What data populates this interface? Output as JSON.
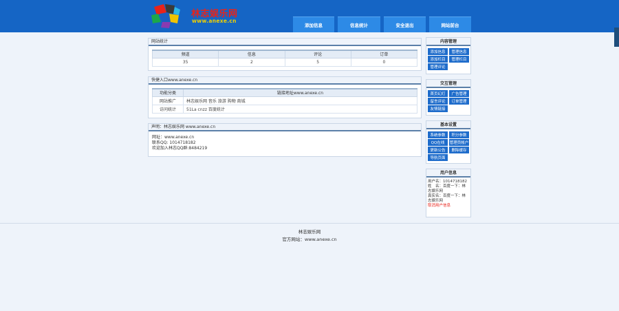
{
  "header": {
    "logo_title": "林志娱乐网",
    "logo_url": "www.anexe.cn",
    "nav": [
      "添加信息",
      "信息统计",
      "安全退出",
      "网站前台"
    ]
  },
  "stats": {
    "title": "网站统计",
    "headers": [
      "频道",
      "信息",
      "评论",
      "订单"
    ],
    "values": [
      "35",
      "2",
      "5",
      "0"
    ]
  },
  "quick": {
    "title": "快捷入口www.anexe.cn",
    "headers": [
      "功能分类",
      "链接地址www.anexe.cn"
    ],
    "rows": [
      [
        "网站推广",
        "林志娱乐网 音乐 旅游 购物 商城"
      ],
      [
        "访问统计",
        "51La cnzz 百度统计"
      ]
    ]
  },
  "statement": {
    "title": "声明：林志娱乐网 www.anexe.cn",
    "lines": [
      "网址：www.anexe.cn",
      "联系QQ: 1014718182",
      "欢迎加入林志QQ群:8484219"
    ]
  },
  "sidebar": {
    "content": {
      "title": "内容管理",
      "buttons": [
        "添加信息",
        "管理信息",
        "添加栏目",
        "管理栏目",
        "管理评论"
      ]
    },
    "interact": {
      "title": "交互管理",
      "buttons": [
        "首页幻灯",
        "广告管理",
        "留言评论",
        "订单管理",
        "友情链接"
      ]
    },
    "basic": {
      "title": "基本设置",
      "buttons": [
        "系统参数",
        "积分参数",
        "QQ在线",
        "管理员帐户",
        "更新公告",
        "删除缓存",
        "导航页面"
      ]
    },
    "user": {
      "title": "用户信息",
      "lines": [
        "用户名：1014718182",
        "姓　名：百度一下：林",
        "志娱乐网",
        "真实名：百度一下：林",
        "志娱乐网"
      ],
      "logout": "取消用户信息"
    }
  },
  "footer": {
    "name": "林志娱乐网",
    "site": "官方网站：www.anexe.cn"
  }
}
